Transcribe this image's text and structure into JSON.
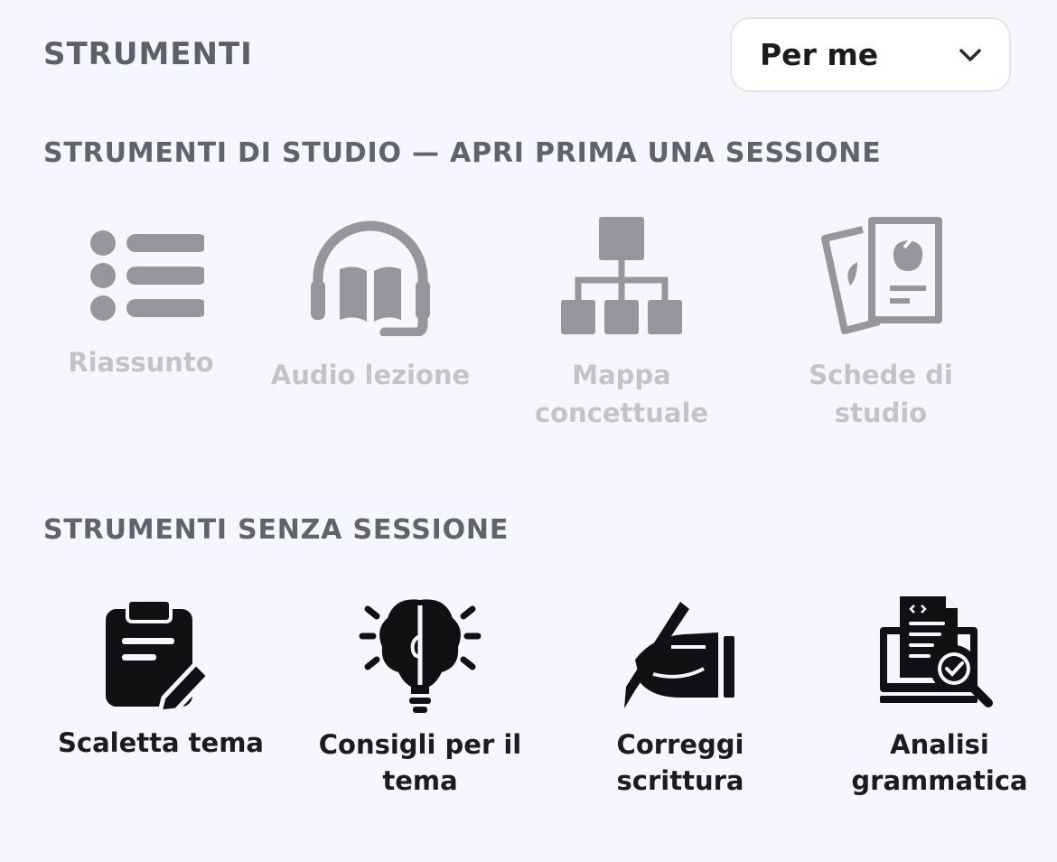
{
  "header": {
    "title": "STRUMENTI"
  },
  "audience_select": {
    "value": "Per me",
    "icon": "chevron-down-icon"
  },
  "study_tools": {
    "title": "STRUMENTI DI STUDIO — APRI PRIMA UNA SESSIONE",
    "items": [
      {
        "label": "Riassunto",
        "icon": "list-icon"
      },
      {
        "label": "Audio lezione",
        "icon": "headphones-book-icon"
      },
      {
        "label_line1": "Mappa",
        "label_line2": "concettuale",
        "icon": "concept-map-icon"
      },
      {
        "label_line1": "Schede di",
        "label_line2": "studio",
        "icon": "flashcards-icon"
      }
    ],
    "state": "disabled",
    "icon_color": "#97969c"
  },
  "free_tools": {
    "title": "STRUMENTI SENZA SESSIONE",
    "items": [
      {
        "label": "Scaletta tema",
        "icon": "clipboard-pencil-icon"
      },
      {
        "label_line1": "Consigli per il",
        "label_line2": "tema",
        "icon": "brain-bulb-icon"
      },
      {
        "label_line1": "Correggi",
        "label_line2": "scrittura",
        "icon": "hand-writing-icon"
      },
      {
        "label_line1": "Analisi",
        "label_line2": "grammatica",
        "icon": "document-magnifier-icon"
      }
    ],
    "icon_color": "#111114"
  }
}
